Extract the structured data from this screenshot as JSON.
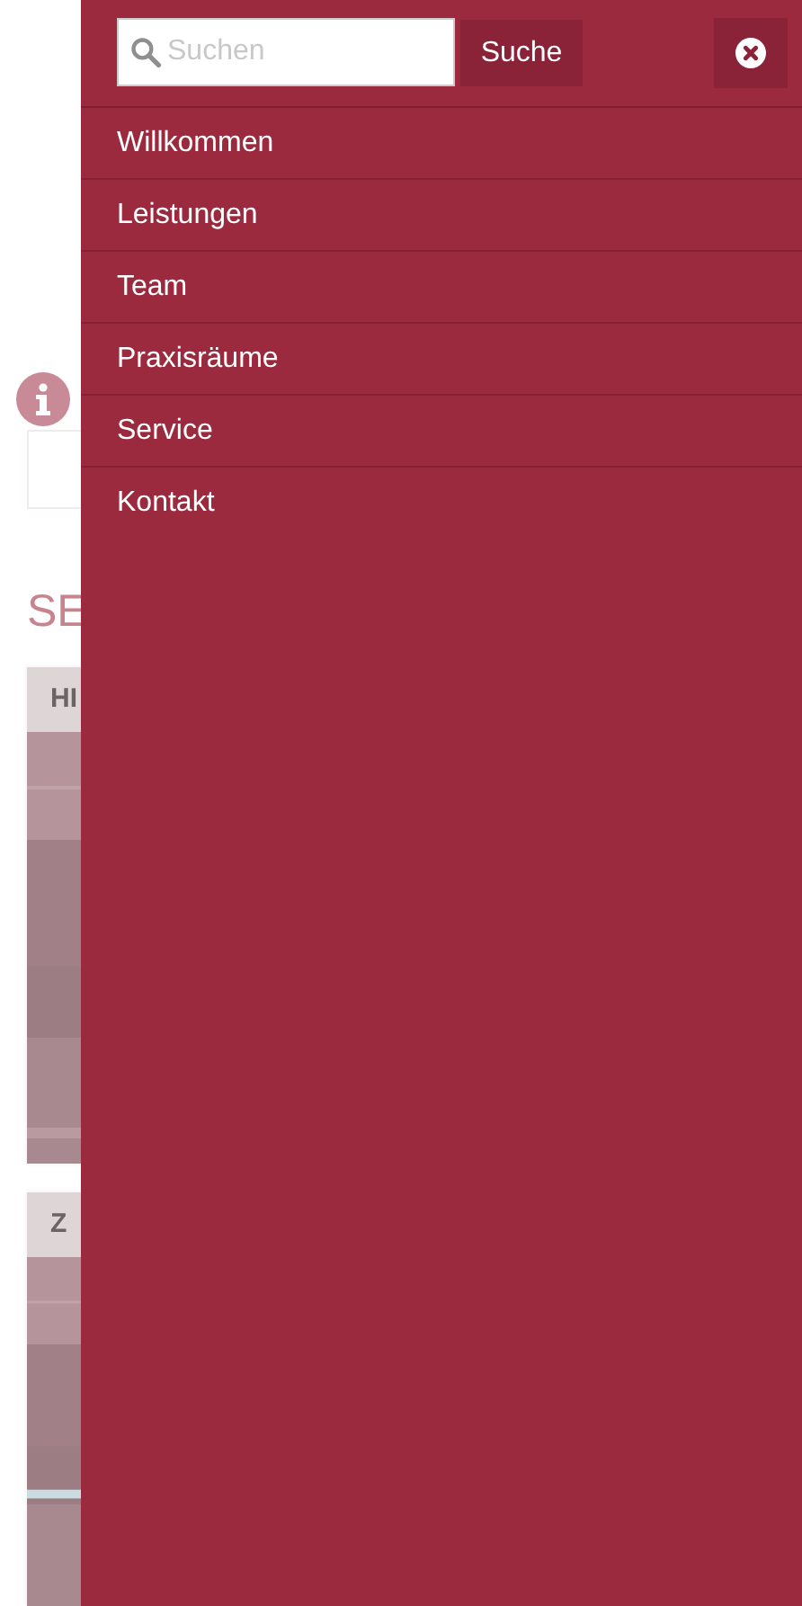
{
  "background_page": {
    "heading": "SE",
    "cards": [
      {
        "title": "HI",
        "kind": "picture"
      },
      {
        "title": "Z",
        "kind": "picture"
      }
    ]
  },
  "drawer": {
    "search": {
      "placeholder": "Suchen"
    },
    "search_button": "Suche",
    "menu": [
      {
        "label": "Willkommen"
      },
      {
        "label": "Leistungen"
      },
      {
        "label": "Team"
      },
      {
        "label": "Praxisräume"
      },
      {
        "label": "Service"
      },
      {
        "label": "Kontakt"
      }
    ]
  }
}
